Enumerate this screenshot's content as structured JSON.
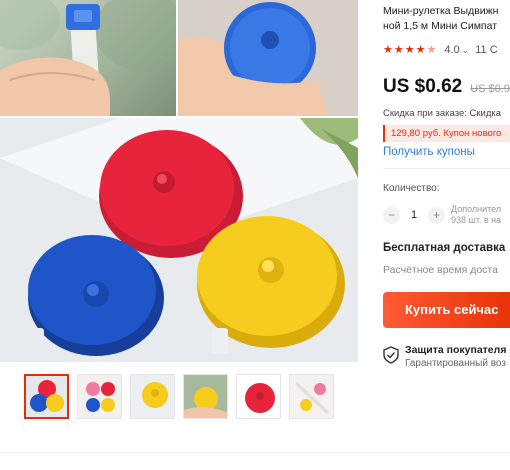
{
  "product": {
    "title_line1": "Мини-рулетка Выдвижн",
    "title_line2": "ной 1,5 м Мини Симпат",
    "rating": "4.0",
    "stars_filled": 4,
    "orders": "11 С"
  },
  "price": {
    "current": "US $0.62",
    "old": "US $0.9"
  },
  "promo": {
    "discount_text": "Скидка при заказе: Скидка",
    "coupon_text": "129,80 руб. Купон нового",
    "get_coupons": "Получить купоны"
  },
  "quantity": {
    "label": "Количество:",
    "minus": "−",
    "value": "1",
    "plus": "+",
    "available_line1": "Дополнител",
    "available_line2": "938 шт. в на"
  },
  "shipping": {
    "title": "Бесплатная доставка",
    "subtitle": "Расчётное время доста"
  },
  "buy": {
    "label": "Купить сейчас"
  },
  "protection": {
    "title": "Защита покупателя",
    "subtitle": "Гарантированный воз"
  },
  "colors": {
    "accent": "#e62e04",
    "link": "#2e7dd7",
    "tape_red": "#e8243d",
    "tape_blue": "#1f55c9",
    "tape_yellow": "#f6cd1f"
  },
  "icons": {
    "star": "star-icon",
    "shield": "shield-check-icon"
  }
}
